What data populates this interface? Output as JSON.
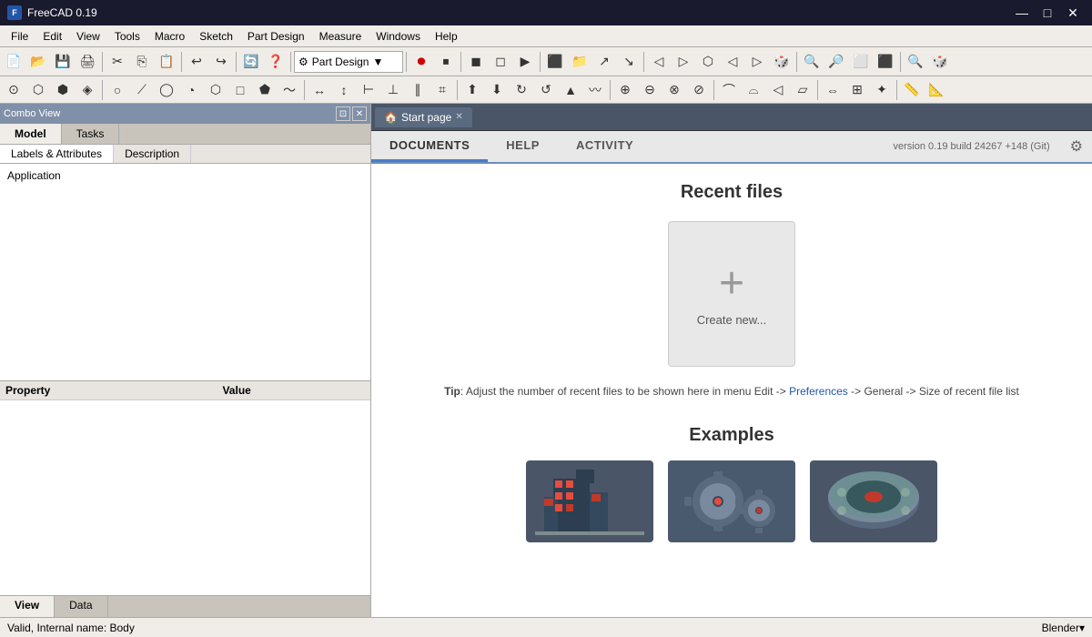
{
  "titlebar": {
    "title": "FreeCAD 0.19",
    "icon": "F",
    "controls": {
      "minimize": "—",
      "maximize": "□",
      "close": "✕"
    }
  },
  "menubar": {
    "items": [
      "File",
      "Edit",
      "View",
      "Tools",
      "Macro",
      "Sketch",
      "Part Design",
      "Measure",
      "Windows",
      "Help"
    ]
  },
  "toolbar1": {
    "dropdown": "Part Design",
    "dropdown_arrow": "▼"
  },
  "combo_view": {
    "header": "Combo View",
    "tabs": [
      "Model",
      "Tasks"
    ],
    "active_tab": "Model",
    "subtabs": [
      "Labels & Attributes",
      "Description"
    ],
    "active_subtab": "Labels & Attributes",
    "tree_items": [
      "Application"
    ]
  },
  "property": {
    "header_property": "Property",
    "header_value": "Value",
    "bottom_tabs": [
      "View",
      "Data"
    ],
    "active_bottom_tab": "View"
  },
  "start_page": {
    "tab_label": "Start page",
    "close": "✕"
  },
  "doc_tabs": {
    "tabs": [
      "DOCUMENTS",
      "HELP",
      "ACTIVITY"
    ],
    "active": "DOCUMENTS"
  },
  "version_info": "version 0.19 build 24267 +148 (Git)",
  "recent_files": {
    "title": "Recent files",
    "create_new_plus": "+",
    "create_new_label": "Create new..."
  },
  "tip": {
    "prefix": "Tip",
    "text": ": Adjust the number of recent files to be shown here in menu Edit -> ",
    "link": "Preferences",
    "suffix": " -> General -> Size of recent file list"
  },
  "examples": {
    "title": "Examples",
    "items": [
      {
        "id": "example1",
        "color1": "#c0392b",
        "color2": "#2c3e50",
        "color3": "#7f8c8d"
      },
      {
        "id": "example2",
        "color1": "#e67e22",
        "color2": "#2c3e50",
        "color3": "#bdc3c7"
      },
      {
        "id": "example3",
        "color1": "#27ae60",
        "color2": "#2c3e50",
        "color3": "#95a5a6"
      }
    ]
  },
  "statusbar": {
    "left": "Valid, Internal name: Body",
    "right": "Blender▾"
  }
}
